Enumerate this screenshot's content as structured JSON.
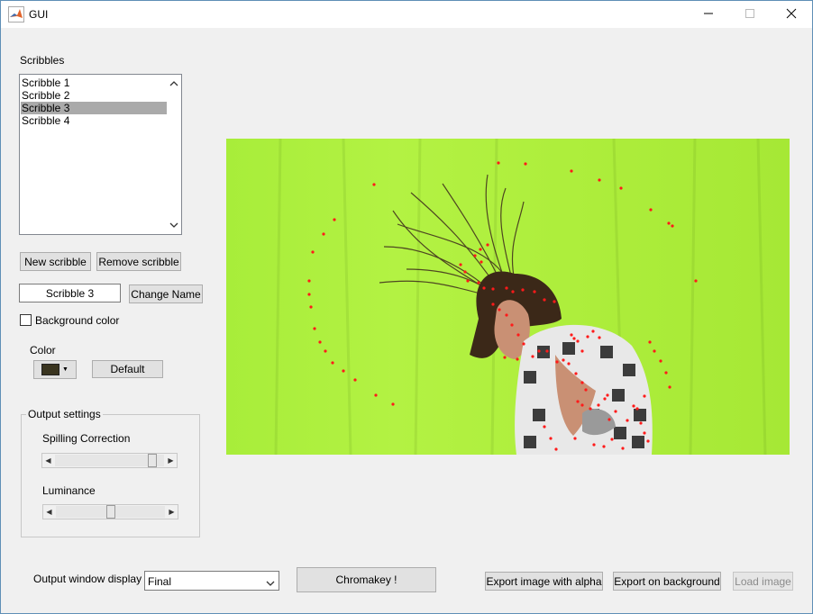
{
  "window": {
    "title": "GUI"
  },
  "scribbles": {
    "label": "Scribbles",
    "items": [
      "Scribble 1",
      "Scribble 2",
      "Scribble 3",
      "Scribble 4"
    ],
    "selected_index": 2,
    "new_button": "New scribble",
    "remove_button": "Remove scribble",
    "name_value": "Scribble 3",
    "change_name_button": "Change Name",
    "background_color_label": "Background color",
    "background_color_checked": false
  },
  "color": {
    "label": "Color",
    "swatch": "#3a3520",
    "default_button": "Default"
  },
  "output_settings": {
    "title": "Output settings",
    "spilling_label": "Spilling Correction",
    "spilling_value": 0.93,
    "luminance_label": "Luminance",
    "luminance_value": 0.5
  },
  "bottom": {
    "display_label": "Output window display",
    "display_value": "Final",
    "chromakey_button": "Chromakey !",
    "export_alpha_button": "Export image with alpha",
    "export_background_button": "Export on background",
    "load_image_button": "Load image"
  },
  "colors": {
    "scribble_dot": "#ff1a1a",
    "green_screen": "#adef3c"
  },
  "icons": {
    "app": "matlab-icon",
    "minimize": "minimize-icon",
    "maximize": "maximize-icon",
    "close": "close-icon"
  }
}
